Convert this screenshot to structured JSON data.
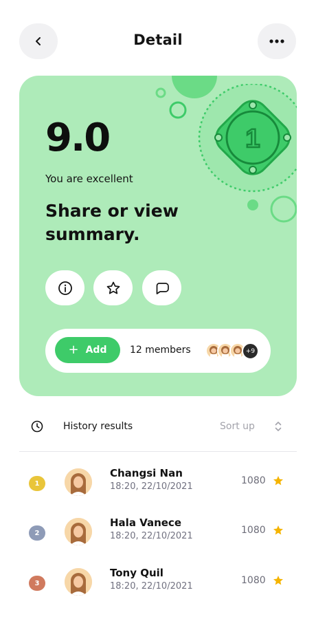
{
  "header": {
    "title": "Detail",
    "back_icon": "chevron-left-icon",
    "more_icon": "more-horizontal-icon"
  },
  "card": {
    "background": "#aeebb9",
    "accent": "#3ecb69",
    "badge_number": "1",
    "score": "9.0",
    "tagline": "You are excellent",
    "headline": "Share or view summary.",
    "actions": [
      {
        "icon": "info-icon"
      },
      {
        "icon": "star-outline-icon"
      },
      {
        "icon": "chat-bubble-icon"
      }
    ],
    "add_label": "Add",
    "members_label": "12 members",
    "more_count": "+9"
  },
  "history": {
    "title": "History results",
    "sort_label": "Sort up",
    "rows": [
      {
        "rank": "1",
        "rank_color": "#e9c53a",
        "name": "Changsi Nan",
        "datetime": "18:20, 22/10/2021",
        "score": "1080"
      },
      {
        "rank": "2",
        "rank_color": "#8e9bb7",
        "name": "Hala Vanece",
        "datetime": "18:20, 22/10/2021",
        "score": "1080"
      },
      {
        "rank": "3",
        "rank_color": "#d07a5e",
        "name": "Tony Quil",
        "datetime": "18:20, 22/10/2021",
        "score": "1080"
      }
    ],
    "star_color": "#f5b400"
  }
}
